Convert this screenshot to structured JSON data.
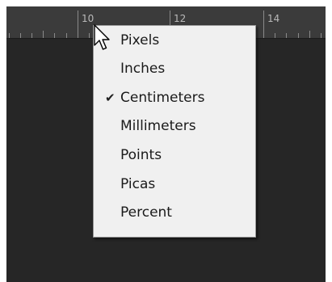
{
  "ruler": {
    "numbers": [
      "10",
      "12",
      "14"
    ]
  },
  "units_menu": {
    "selected": "Centimeters",
    "items": [
      {
        "label": "Pixels",
        "checked": false
      },
      {
        "label": "Inches",
        "checked": false
      },
      {
        "label": "Centimeters",
        "checked": true
      },
      {
        "label": "Millimeters",
        "checked": false
      },
      {
        "label": "Points",
        "checked": false
      },
      {
        "label": "Picas",
        "checked": false
      },
      {
        "label": "Percent",
        "checked": false
      }
    ],
    "check_glyph": "✔"
  },
  "icons": {
    "checkmark": "checkmark-icon",
    "cursor": "arrow-cursor-icon"
  },
  "colors": {
    "workspace": "#262626",
    "ruler": "#3b3b3b",
    "menu_bg": "#f0f0f0"
  }
}
